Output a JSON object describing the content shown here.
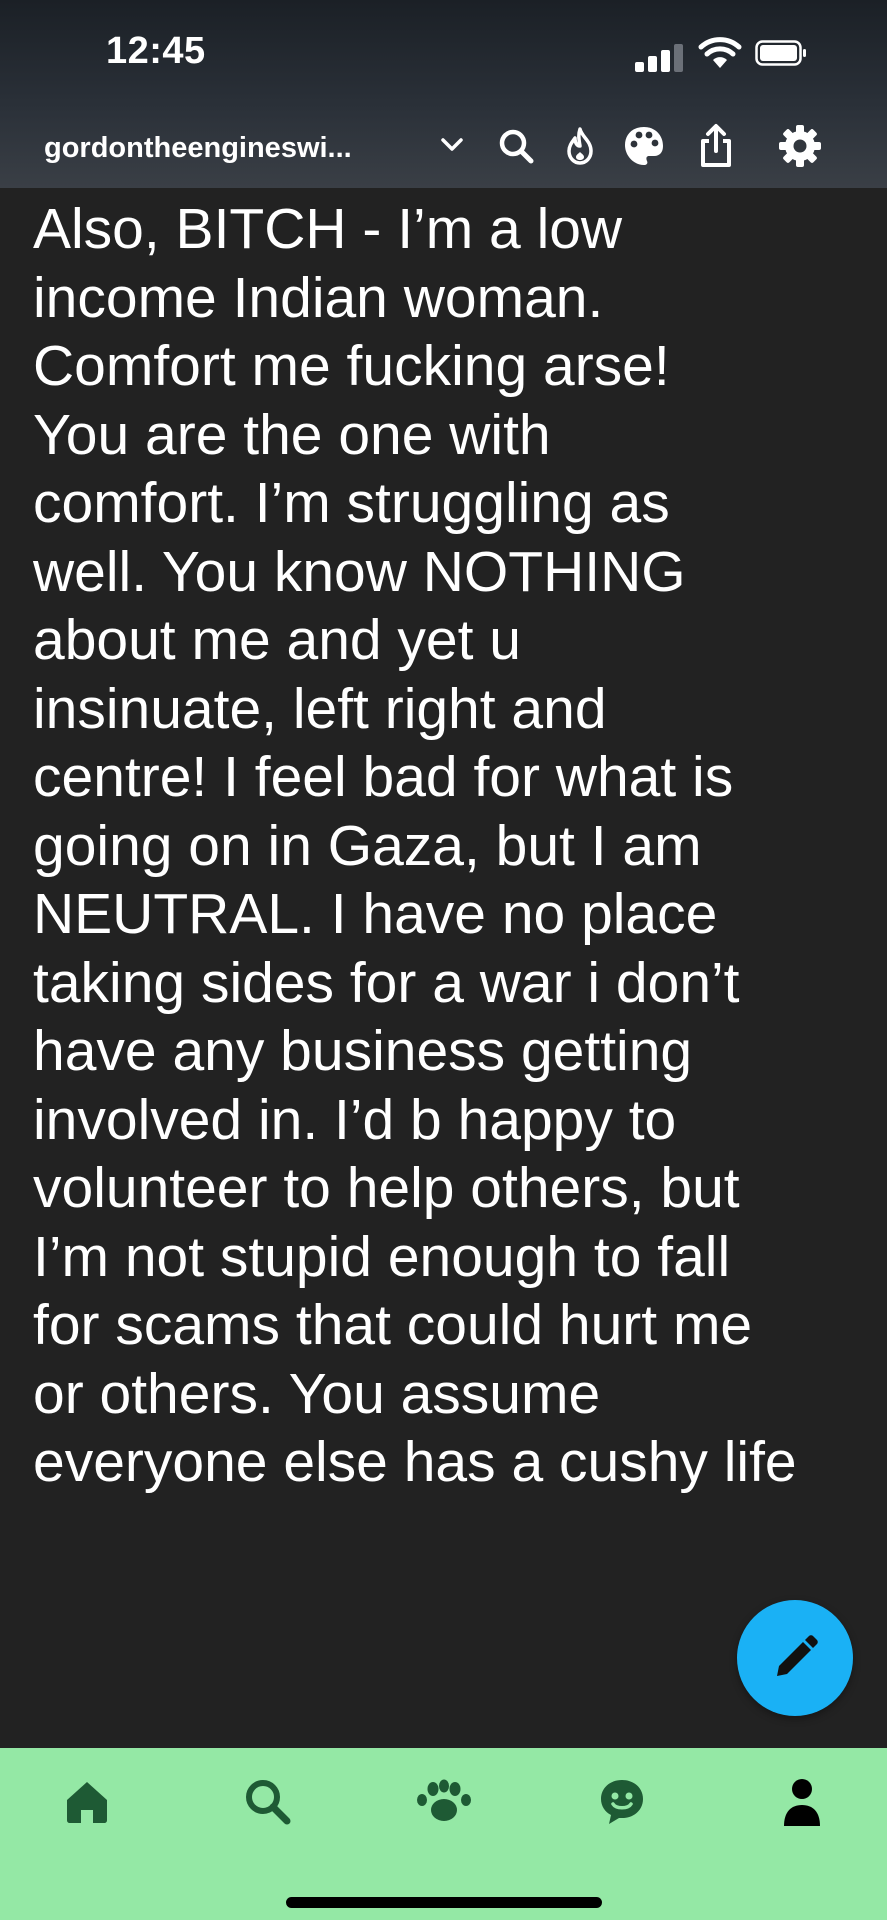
{
  "status_bar": {
    "time": "12:45"
  },
  "header": {
    "blog_name": "gordontheengineswi...",
    "icons": [
      "chevron-down-icon",
      "search-icon",
      "flame-icon",
      "palette-icon",
      "share-icon",
      "gear-icon"
    ]
  },
  "post": {
    "lines": [
      "Also, BITCH - I’m a low",
      "income Indian woman.",
      "Comfort me fucking arse!",
      "You are the one with",
      "comfort. I’m struggling as",
      "well. You know NOTHING",
      "about me and yet u",
      "insinuate, left right and",
      "centre! I feel bad for what is",
      "going on in Gaza, but I am",
      "NEUTRAL. I have no place",
      "taking sides for a war i don’t",
      "have any business getting",
      "involved in. I’d b happy to",
      "volunteer to help others, but",
      "I’m not stupid enough to fall",
      "for scams that could hurt me",
      "or others. You assume",
      "everyone else has a cushy life"
    ]
  },
  "fab": {
    "icon": "pencil-icon"
  },
  "bottom_nav": {
    "items": [
      "home-icon",
      "search-icon",
      "community-icon",
      "activity-icon",
      "account-icon"
    ]
  },
  "colors": {
    "background": "#222222",
    "text": "#ffffff",
    "accent_blue": "#1ab1f5",
    "nav_green": "#94e8a5",
    "nav_icon": "#1e5a34"
  }
}
